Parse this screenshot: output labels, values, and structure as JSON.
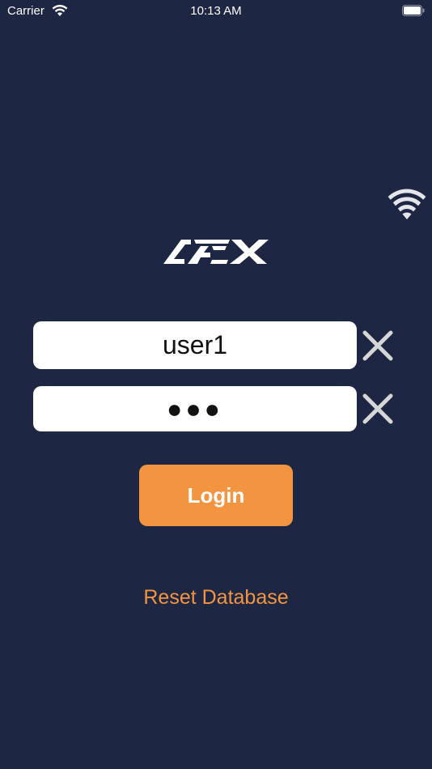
{
  "status_bar": {
    "carrier": "Carrier",
    "time": "10:13 AM"
  },
  "icons": {
    "status_wifi": "wifi-icon",
    "battery": "battery-icon",
    "network": "wifi-signal-icon",
    "clear": "close-icon"
  },
  "login_form": {
    "username_value": "user1",
    "password_value": "●●●",
    "login_label": "Login",
    "reset_label": "Reset Database"
  },
  "colors": {
    "background": "#1d2744",
    "accent": "#f39440",
    "field": "#ffffff"
  }
}
